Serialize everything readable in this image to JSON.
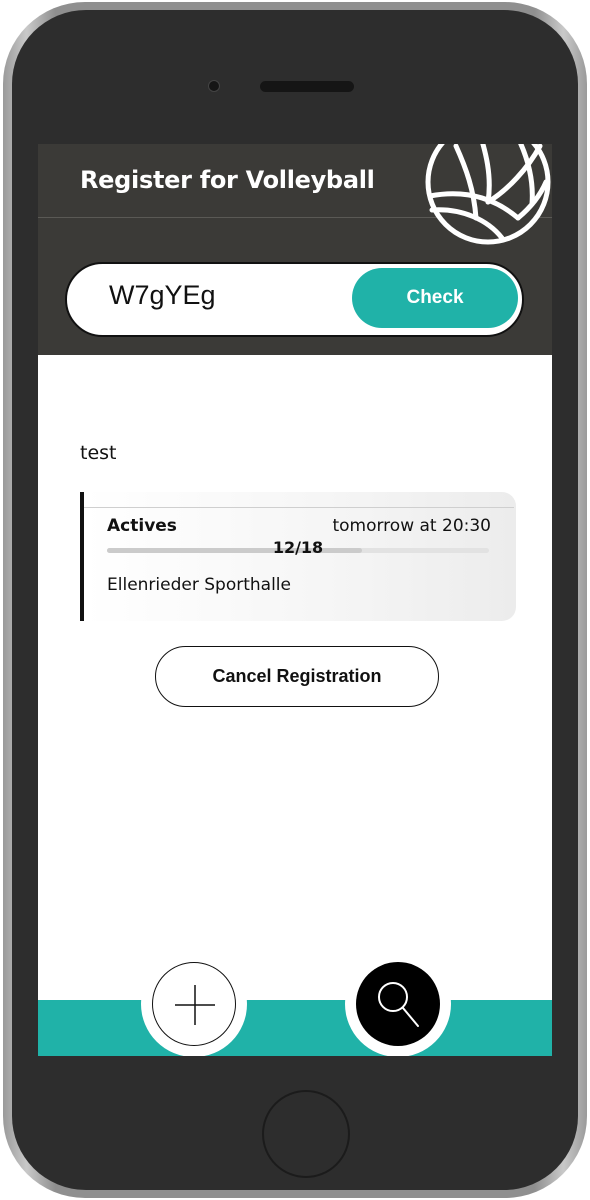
{
  "header": {
    "title": "Register for Volleyball"
  },
  "code_check": {
    "code_value": "W7gYEg",
    "check_label": "Check"
  },
  "event": {
    "title": "test",
    "group": "Actives",
    "time": "tomorrow at 20:30",
    "registered": 12,
    "capacity": 18,
    "progress_label": "12/18",
    "location": "Ellenrieder Sporthalle"
  },
  "actions": {
    "cancel_label": "Cancel Registration"
  },
  "bottom_nav": {
    "add_icon": "plus-icon",
    "search_icon": "search-icon"
  },
  "colors": {
    "accent": "#20b2a8",
    "header_bg": "#3b3a37",
    "phone_body": "#2d2d2d"
  }
}
